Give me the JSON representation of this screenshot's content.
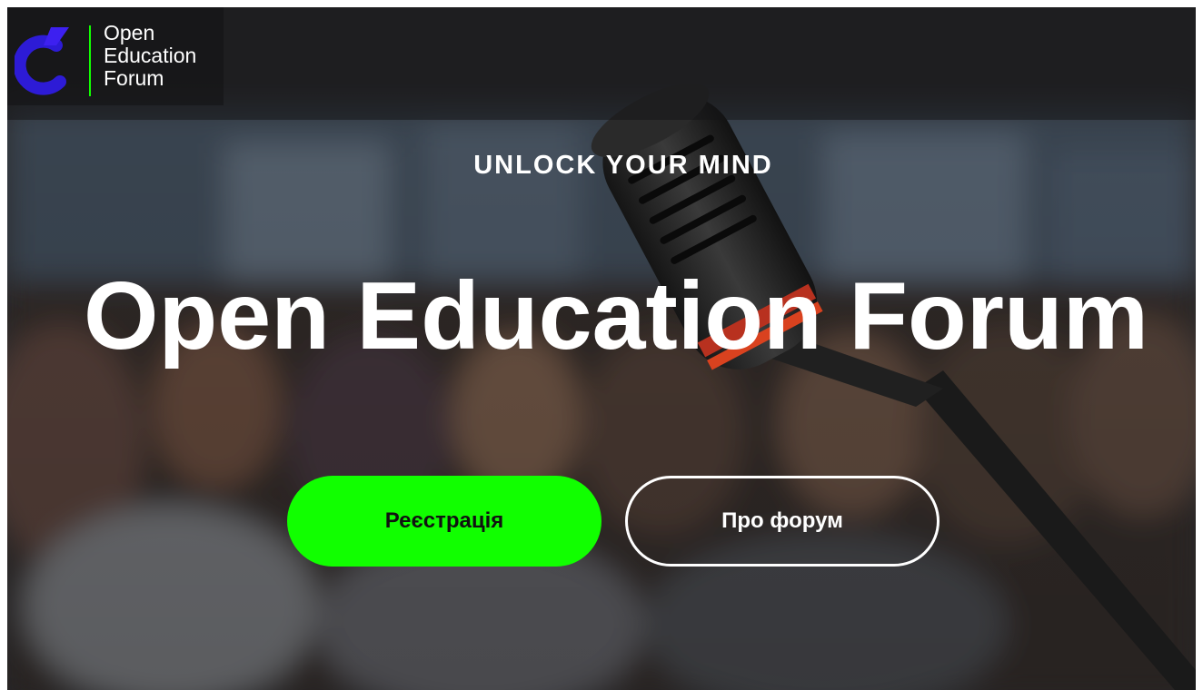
{
  "brand": {
    "logo_lines": [
      "Open",
      "Education",
      "Forum"
    ],
    "accent_color": "#11ff00",
    "logo_mark_color": "#2d1bd6"
  },
  "hero": {
    "tagline": "UNLOCK YOUR MIND",
    "title": "Open Education Forum",
    "background": "conference-microphone-photo"
  },
  "actions": {
    "register_label": "Реєстрація",
    "about_label": "Про форум"
  }
}
